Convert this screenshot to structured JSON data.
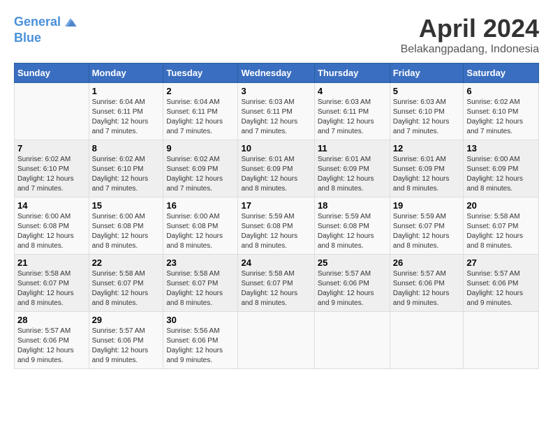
{
  "header": {
    "logo_line1": "General",
    "logo_line2": "Blue",
    "month_year": "April 2024",
    "location": "Belakangpadang, Indonesia"
  },
  "weekdays": [
    "Sunday",
    "Monday",
    "Tuesday",
    "Wednesday",
    "Thursday",
    "Friday",
    "Saturday"
  ],
  "weeks": [
    [
      {
        "day": "",
        "info": ""
      },
      {
        "day": "1",
        "info": "Sunrise: 6:04 AM\nSunset: 6:11 PM\nDaylight: 12 hours\nand 7 minutes."
      },
      {
        "day": "2",
        "info": "Sunrise: 6:04 AM\nSunset: 6:11 PM\nDaylight: 12 hours\nand 7 minutes."
      },
      {
        "day": "3",
        "info": "Sunrise: 6:03 AM\nSunset: 6:11 PM\nDaylight: 12 hours\nand 7 minutes."
      },
      {
        "day": "4",
        "info": "Sunrise: 6:03 AM\nSunset: 6:11 PM\nDaylight: 12 hours\nand 7 minutes."
      },
      {
        "day": "5",
        "info": "Sunrise: 6:03 AM\nSunset: 6:10 PM\nDaylight: 12 hours\nand 7 minutes."
      },
      {
        "day": "6",
        "info": "Sunrise: 6:02 AM\nSunset: 6:10 PM\nDaylight: 12 hours\nand 7 minutes."
      }
    ],
    [
      {
        "day": "7",
        "info": "Sunrise: 6:02 AM\nSunset: 6:10 PM\nDaylight: 12 hours\nand 7 minutes."
      },
      {
        "day": "8",
        "info": "Sunrise: 6:02 AM\nSunset: 6:10 PM\nDaylight: 12 hours\nand 7 minutes."
      },
      {
        "day": "9",
        "info": "Sunrise: 6:02 AM\nSunset: 6:09 PM\nDaylight: 12 hours\nand 7 minutes."
      },
      {
        "day": "10",
        "info": "Sunrise: 6:01 AM\nSunset: 6:09 PM\nDaylight: 12 hours\nand 8 minutes."
      },
      {
        "day": "11",
        "info": "Sunrise: 6:01 AM\nSunset: 6:09 PM\nDaylight: 12 hours\nand 8 minutes."
      },
      {
        "day": "12",
        "info": "Sunrise: 6:01 AM\nSunset: 6:09 PM\nDaylight: 12 hours\nand 8 minutes."
      },
      {
        "day": "13",
        "info": "Sunrise: 6:00 AM\nSunset: 6:09 PM\nDaylight: 12 hours\nand 8 minutes."
      }
    ],
    [
      {
        "day": "14",
        "info": "Sunrise: 6:00 AM\nSunset: 6:08 PM\nDaylight: 12 hours\nand 8 minutes."
      },
      {
        "day": "15",
        "info": "Sunrise: 6:00 AM\nSunset: 6:08 PM\nDaylight: 12 hours\nand 8 minutes."
      },
      {
        "day": "16",
        "info": "Sunrise: 6:00 AM\nSunset: 6:08 PM\nDaylight: 12 hours\nand 8 minutes."
      },
      {
        "day": "17",
        "info": "Sunrise: 5:59 AM\nSunset: 6:08 PM\nDaylight: 12 hours\nand 8 minutes."
      },
      {
        "day": "18",
        "info": "Sunrise: 5:59 AM\nSunset: 6:08 PM\nDaylight: 12 hours\nand 8 minutes."
      },
      {
        "day": "19",
        "info": "Sunrise: 5:59 AM\nSunset: 6:07 PM\nDaylight: 12 hours\nand 8 minutes."
      },
      {
        "day": "20",
        "info": "Sunrise: 5:58 AM\nSunset: 6:07 PM\nDaylight: 12 hours\nand 8 minutes."
      }
    ],
    [
      {
        "day": "21",
        "info": "Sunrise: 5:58 AM\nSunset: 6:07 PM\nDaylight: 12 hours\nand 8 minutes."
      },
      {
        "day": "22",
        "info": "Sunrise: 5:58 AM\nSunset: 6:07 PM\nDaylight: 12 hours\nand 8 minutes."
      },
      {
        "day": "23",
        "info": "Sunrise: 5:58 AM\nSunset: 6:07 PM\nDaylight: 12 hours\nand 8 minutes."
      },
      {
        "day": "24",
        "info": "Sunrise: 5:58 AM\nSunset: 6:07 PM\nDaylight: 12 hours\nand 8 minutes."
      },
      {
        "day": "25",
        "info": "Sunrise: 5:57 AM\nSunset: 6:06 PM\nDaylight: 12 hours\nand 9 minutes."
      },
      {
        "day": "26",
        "info": "Sunrise: 5:57 AM\nSunset: 6:06 PM\nDaylight: 12 hours\nand 9 minutes."
      },
      {
        "day": "27",
        "info": "Sunrise: 5:57 AM\nSunset: 6:06 PM\nDaylight: 12 hours\nand 9 minutes."
      }
    ],
    [
      {
        "day": "28",
        "info": "Sunrise: 5:57 AM\nSunset: 6:06 PM\nDaylight: 12 hours\nand 9 minutes."
      },
      {
        "day": "29",
        "info": "Sunrise: 5:57 AM\nSunset: 6:06 PM\nDaylight: 12 hours\nand 9 minutes."
      },
      {
        "day": "30",
        "info": "Sunrise: 5:56 AM\nSunset: 6:06 PM\nDaylight: 12 hours\nand 9 minutes."
      },
      {
        "day": "",
        "info": ""
      },
      {
        "day": "",
        "info": ""
      },
      {
        "day": "",
        "info": ""
      },
      {
        "day": "",
        "info": ""
      }
    ]
  ]
}
